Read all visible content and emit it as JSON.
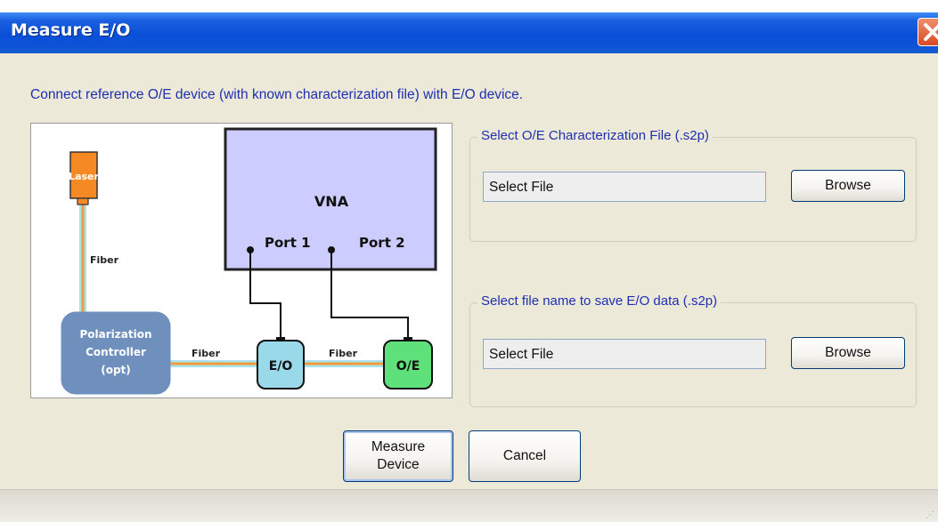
{
  "window": {
    "title": "Measure E/O",
    "close_icon": "close-x-icon"
  },
  "instruction": "Connect reference O/E device (with known characterization file) with E/O device.",
  "diagram": {
    "laser": "Laser",
    "fiber_vertical": "Fiber",
    "controller_line1": "Polarization",
    "controller_line2": "Controller",
    "controller_line3": "(opt)",
    "fiber_left": "Fiber",
    "fiber_right": "Fiber",
    "vna": "VNA",
    "port1": "Port 1",
    "port2": "Port 2",
    "eo": "E/O",
    "oe": "O/E",
    "colors": {
      "laser": "#f58a24",
      "vna": "#ccccff",
      "controller": "#6f8fbd",
      "eo": "#99d9ea",
      "oe": "#5ee07a",
      "fiber": "#f39a3a"
    }
  },
  "oe_group": {
    "title": "Select O/E Characterization File (.s2p)",
    "file_value": "Select File",
    "browse_label": "Browse"
  },
  "save_group": {
    "title": "Select file name to save E/O data (.s2p)",
    "file_value": "Select File",
    "browse_label": "Browse"
  },
  "buttons": {
    "measure_line1": "Measure",
    "measure_line2": "Device",
    "cancel": "Cancel"
  }
}
